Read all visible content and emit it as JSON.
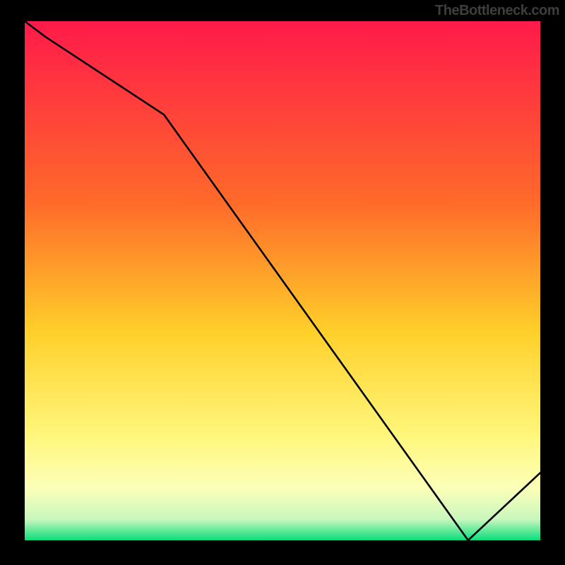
{
  "chart_data": {
    "type": "line",
    "x": [
      0,
      4,
      27,
      86,
      100
    ],
    "values": [
      100,
      97,
      82,
      0,
      13
    ],
    "title": "",
    "xlabel": "",
    "ylabel": "",
    "xlim": [
      0,
      100
    ],
    "ylim": [
      0,
      100
    ],
    "gradient_stops": [
      {
        "offset": 0,
        "color": "#ff1a4a"
      },
      {
        "offset": 35,
        "color": "#ff6a2a"
      },
      {
        "offset": 60,
        "color": "#ffd02a"
      },
      {
        "offset": 80,
        "color": "#fff77d"
      },
      {
        "offset": 90,
        "color": "#fcffb8"
      },
      {
        "offset": 96,
        "color": "#c8f7bd"
      },
      {
        "offset": 100,
        "color": "#09dd7b"
      }
    ],
    "marker_label": ""
  },
  "watermark": "TheBottleneck.com"
}
